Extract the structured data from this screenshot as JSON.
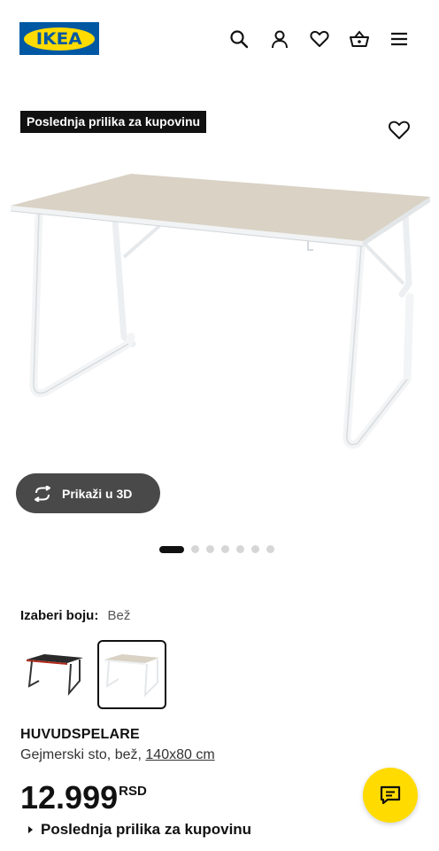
{
  "header": {
    "logo_text": "IKEA",
    "icons": [
      "search-icon",
      "user-icon",
      "heart-icon",
      "basket-icon",
      "menu-icon"
    ]
  },
  "product": {
    "badge": "Poslednja prilika za kupovinu",
    "view3d_label": "Prikaži u 3D",
    "carousel": {
      "total": 7,
      "active": 1
    },
    "color_label": "Izaberi boju:",
    "color_value": "Bež",
    "swatches": [
      {
        "name": "black-red",
        "selected": false
      },
      {
        "name": "beige",
        "selected": true
      }
    ],
    "name": "HUVUDSPELARE",
    "desc": "Gejmerski sto, bež,",
    "size": "140x80 cm",
    "price": "12.999",
    "currency": "RSD",
    "availability": "Poslednja prilika za kupovinu"
  },
  "colors": {
    "brand_blue": "#0058a3",
    "brand_yellow": "#ffdb00",
    "dark_button": "#494949"
  }
}
